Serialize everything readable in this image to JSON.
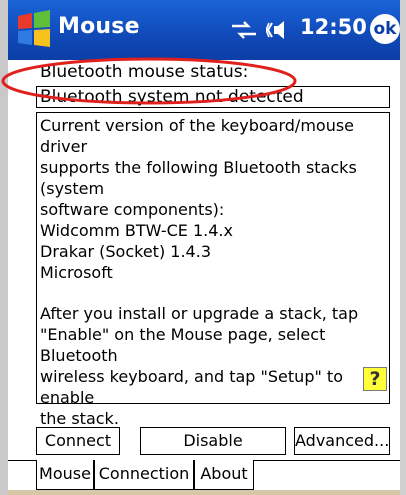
{
  "titlebar": {
    "app_title": "Mouse",
    "clock": "12:50",
    "ok_label": "ok"
  },
  "status": {
    "label": "Bluetooth mouse status:",
    "value": "Bluetooth system not detected",
    "highlight_color": "#e0201c"
  },
  "info": {
    "paragraph1": "Current version of the keyboard/mouse driver\nsupports the following Bluetooth stacks (system\nsoftware components):\nWidcomm BTW-CE 1.4.x\nDrakar (Socket) 1.4.3\nMicrosoft",
    "paragraph2": "After you install or upgrade a stack, tap\n\"Enable\" on the Mouse page, select Bluetooth\nwireless keyboard, and tap \"Setup\" to enable\nthe stack.",
    "help_label": "?"
  },
  "buttons": {
    "connect": "Connect",
    "disable": "Disable",
    "advanced": "Advanced..."
  },
  "tabs": [
    {
      "label": "Mouse",
      "active": false
    },
    {
      "label": "Connection",
      "active": true
    },
    {
      "label": "About",
      "active": false
    }
  ],
  "colors": {
    "titlebar": "#1049b8",
    "bottom_bar": "#d6c7a8",
    "help_icon": "#ffff3a"
  }
}
